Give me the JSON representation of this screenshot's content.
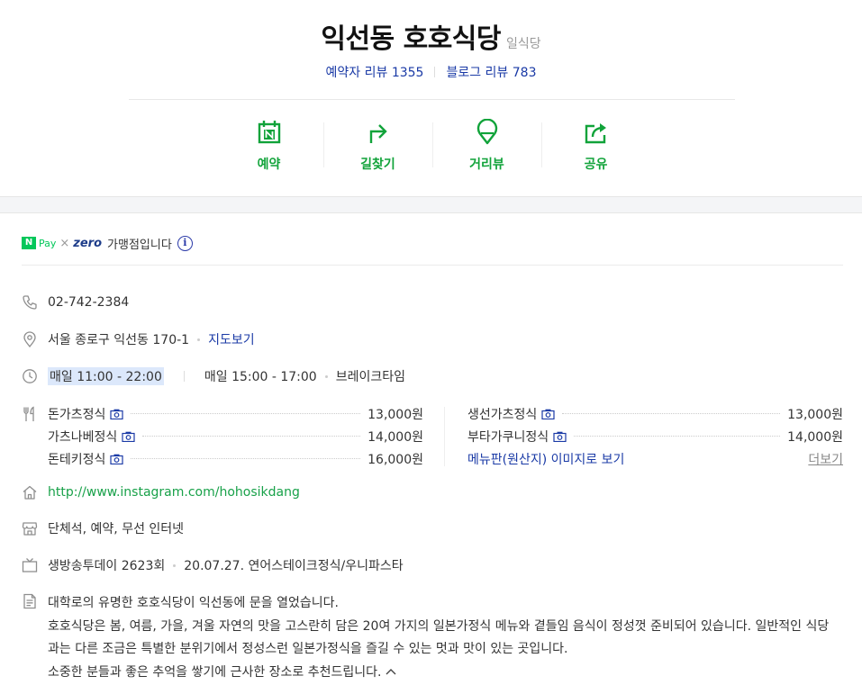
{
  "place": {
    "name": "익선동 호호식당",
    "category": "일식당",
    "visitor_review_label": "예약자 리뷰",
    "visitor_review_count": "1355",
    "blog_review_label": "블로그 리뷰",
    "blog_review_count": "783"
  },
  "actions": [
    {
      "label": "예약",
      "icon": "calendar-n-icon"
    },
    {
      "label": "길찾기",
      "icon": "directions-arrow-icon"
    },
    {
      "label": "거리뷰",
      "icon": "map-pin-icon"
    },
    {
      "label": "공유",
      "icon": "share-icon"
    }
  ],
  "pay": {
    "npay_badge": "N",
    "npay_text": "Pay",
    "times": "×",
    "zero_text": "zero",
    "member_text": "가맹점입니다",
    "info_glyph": "i"
  },
  "phone": "02-742-2384",
  "address": {
    "text": "서울 종로구 익선동 170-1",
    "map_link": "지도보기"
  },
  "hours": {
    "open": "매일 11:00 - 22:00",
    "break_time": "매일 15:00 - 17:00",
    "break_label": "브레이크타임"
  },
  "menu": {
    "left": [
      {
        "name": "돈가츠정식",
        "price": "13,000원"
      },
      {
        "name": "가츠나베정식",
        "price": "14,000원"
      },
      {
        "name": "돈테키정식",
        "price": "16,000원"
      }
    ],
    "right": [
      {
        "name": "생선가츠정식",
        "price": "13,000원"
      },
      {
        "name": "부타가쿠니정식",
        "price": "14,000원"
      }
    ],
    "menu_image_link": "메뉴판(원산지) 이미지로 보기",
    "more_link": "더보기"
  },
  "website": "http://www.instagram.com/hohosikdang",
  "facilities": "단체석, 예약, 무선 인터넷",
  "tv": {
    "program": "생방송투데이 2623회",
    "detail": "20.07.27. 연어스테이크정식/우니파스타"
  },
  "description": [
    "대학로의 유명한 호호식당이 익선동에 문을 열었습니다.",
    "호호식당은 봄, 여름, 가을, 겨울 자연의 맛을 고스란히 담은 20여 가지의 일본가정식 메뉴와 곁들임 음식이 정성껏 준비되어 있습니다.  일반적인 식당",
    "과는 다른  조금은 특별한 분위기에서 정성스런 일본가정식을 즐길 수 있는 멋과 맛이 있는 곳입니다.",
    "소중한 분들과 좋은 추억을 쌓기에 근사한 장소로 추천드립니다."
  ],
  "colors": {
    "brand_green": "#11a33a",
    "npay_green": "#03c75a",
    "link_blue": "#1a3aa6",
    "link_green": "#18a149"
  }
}
